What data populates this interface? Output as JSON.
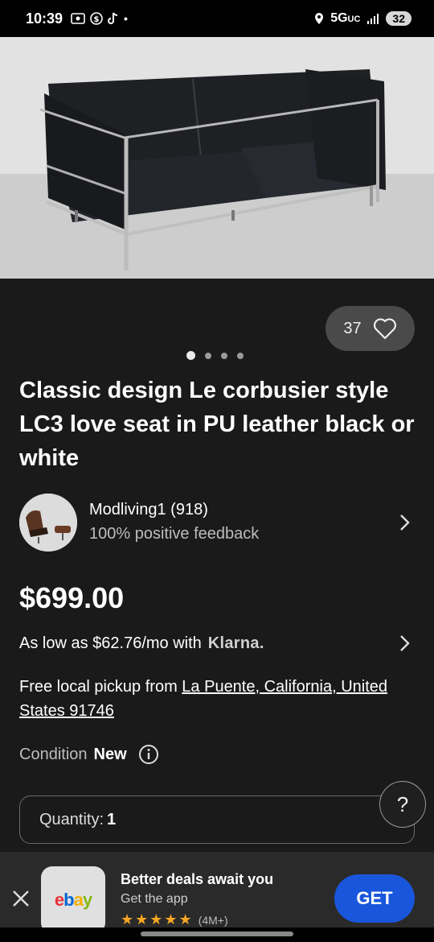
{
  "status_bar": {
    "time": "10:39",
    "network": "5G",
    "network_suffix": "UC",
    "battery": "32"
  },
  "listing": {
    "like_count": "37",
    "image_count": 4,
    "active_image_index": 0,
    "title": "Classic design Le corbusier style LC3 love seat in PU leather black or white",
    "seller": {
      "name": "Modliving1 (918)",
      "feedback": "100% positive feedback"
    },
    "price": "$699.00",
    "financing": {
      "text": "As low as $62.76/mo with",
      "provider": "Klarna."
    },
    "pickup": {
      "prefix": "Free local pickup from ",
      "location": "La Puente, California, United States 91746"
    },
    "condition": {
      "label": "Condition",
      "value": "New"
    },
    "quantity": {
      "label": "Quantity:",
      "value": "1"
    }
  },
  "help_fab": {
    "label": "?"
  },
  "app_banner": {
    "logo_text": "ebay",
    "title": "Better deals await you",
    "subtitle": "Get the app",
    "stars": "★★★★★",
    "rating_count": "(4M+)",
    "get_label": "GET"
  },
  "colors": {
    "background": "#1a1a1a",
    "accent_blue": "#1a56db",
    "pill": "#4a4a4a",
    "star": "#f5a623"
  }
}
